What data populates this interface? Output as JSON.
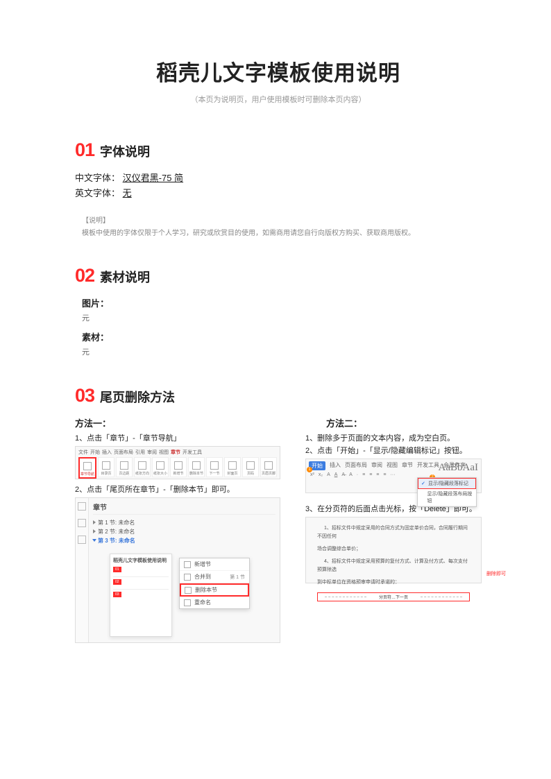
{
  "title": "稻壳儿文字模板使用说明",
  "subtitle": "（本页为说明页，用户使用模板时可删除本页内容）",
  "sections": [
    {
      "num": "01",
      "title": "字体说明"
    },
    {
      "num": "02",
      "title": "素材说明"
    },
    {
      "num": "03",
      "title": "尾页删除方法"
    }
  ],
  "fonts": {
    "cn_label": "中文字体：",
    "cn_value": "汉仪君黑-75 简",
    "en_label": "英文字体：",
    "en_value": "无"
  },
  "note": {
    "heading": "【说明】",
    "body": "模板中使用的字体仅限于个人学习，研究或欣赏目的使用，如需商用请您自行向版权方购买、获取商用版权。"
  },
  "assets": {
    "img_label": "图片：",
    "img_value": "元",
    "mat_label": "素材：",
    "mat_value": "元"
  },
  "method1": {
    "title": "方法一：",
    "step1": "1、点击「章节」-「章节导航」",
    "step2": "2、点击「尾页所在章节」-「删除本节」即可。",
    "ribbon_tabs": [
      "文件",
      "开始",
      "插入",
      "页面布局",
      "引用",
      "审阅",
      "视图",
      "章节",
      "开发工具"
    ],
    "ribbon_icons": [
      "章节导航",
      "目录页",
      "页边距",
      "纸张方向",
      "纸张大小",
      "新增节",
      "删除本节",
      "下一节",
      "封面页",
      "页码",
      "页眉页脚"
    ],
    "panel_head": "章节",
    "tree": {
      "n1": "第 1 节: 未命名",
      "n2": "第 2 节: 未命名",
      "n3": "第 3 节: 未命名"
    },
    "float_head": "稻壳儿文字模板使用说明",
    "menu": {
      "new": "新增节",
      "merge": "合并到",
      "merge_side": "第 1 节",
      "delete": "删除本节",
      "rename": "重命名"
    }
  },
  "method2": {
    "title": "方法二：",
    "step1": "1、删除多于页面的文本内容，成为空白页。",
    "step2": "2、点击「开始」-「显示/隐藏编辑标记」按钮。",
    "step3": "3、在分页符的后面点击光标，按「Delete」即可。",
    "ribbon_tabs": [
      "开始",
      "插入",
      "页面布局",
      "审阅",
      "视图",
      "章节",
      "开发工具",
      "会员专享"
    ],
    "bigA": "AaBbAaI",
    "dropdown": {
      "opt1": "显示/隐藏段落标记",
      "opt2": "显示/隐藏段落布局按钮"
    },
    "para1": "1、招标文件中规定采用的合同方式为固定单价合同，合同履行期间不因任何",
    "para1b": "场合调整综合单价；",
    "para2": "4、招标文件中规定采用预算的复付方式、计算及付方式、每次支付预算除选",
    "para3": "到中标单位在资格预审申请时承诺的：",
    "break": "分页符…下一页",
    "break_note": "删除即可"
  }
}
